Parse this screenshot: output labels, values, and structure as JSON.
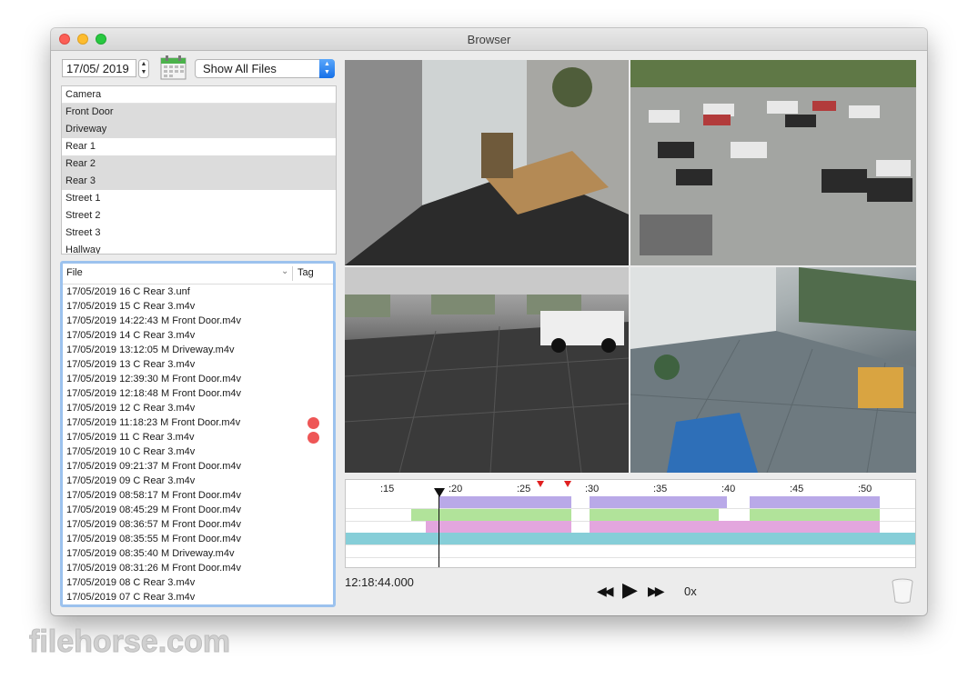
{
  "window": {
    "title": "Browser"
  },
  "toolbar": {
    "date_value": "17/05/ 2019",
    "filter_selected": "Show All Files"
  },
  "cameras": {
    "header": "Camera",
    "items": [
      {
        "label": "Front Door",
        "selected": true
      },
      {
        "label": "Driveway",
        "selected": true
      },
      {
        "label": "Rear 1",
        "selected": false
      },
      {
        "label": "Rear 2",
        "selected": true
      },
      {
        "label": "Rear 3",
        "selected": true
      },
      {
        "label": "Street 1",
        "selected": false
      },
      {
        "label": "Street 2",
        "selected": false
      },
      {
        "label": "Street 3",
        "selected": false
      },
      {
        "label": "Hallway",
        "selected": false
      }
    ]
  },
  "files": {
    "col_file": "File",
    "col_tag": "Tag",
    "rows": [
      {
        "name": "17/05/2019 16 C Rear 3.unf",
        "tag": false
      },
      {
        "name": "17/05/2019 15 C Rear 3.m4v",
        "tag": false
      },
      {
        "name": "17/05/2019 14:22:43 M Front Door.m4v",
        "tag": false
      },
      {
        "name": "17/05/2019 14 C Rear 3.m4v",
        "tag": false
      },
      {
        "name": "17/05/2019 13:12:05 M Driveway.m4v",
        "tag": false
      },
      {
        "name": "17/05/2019 13 C Rear 3.m4v",
        "tag": false
      },
      {
        "name": "17/05/2019 12:39:30 M Front Door.m4v",
        "tag": false
      },
      {
        "name": "17/05/2019 12:18:48 M Front Door.m4v",
        "tag": false
      },
      {
        "name": "17/05/2019 12 C Rear 3.m4v",
        "tag": false
      },
      {
        "name": "17/05/2019 11:18:23 M Front Door.m4v",
        "tag": true
      },
      {
        "name": "17/05/2019 11 C Rear 3.m4v",
        "tag": true
      },
      {
        "name": "17/05/2019 10 C Rear 3.m4v",
        "tag": false
      },
      {
        "name": "17/05/2019 09:21:37 M Front Door.m4v",
        "tag": false
      },
      {
        "name": "17/05/2019 09 C Rear 3.m4v",
        "tag": false
      },
      {
        "name": "17/05/2019 08:58:17 M Front Door.m4v",
        "tag": false
      },
      {
        "name": "17/05/2019 08:45:29 M Front Door.m4v",
        "tag": false
      },
      {
        "name": "17/05/2019 08:36:57 M Front Door.m4v",
        "tag": false
      },
      {
        "name": "17/05/2019 08:35:55 M Front Door.m4v",
        "tag": false
      },
      {
        "name": "17/05/2019 08:35:40 M Driveway.m4v",
        "tag": false
      },
      {
        "name": "17/05/2019 08:31:26 M Front Door.m4v",
        "tag": false
      },
      {
        "name": "17/05/2019 08 C Rear 3.m4v",
        "tag": false
      },
      {
        "name": "17/05/2019 07 C Rear 3.m4v",
        "tag": false
      }
    ]
  },
  "timeline": {
    "ticks": [
      ":15",
      ":20",
      ":25",
      ":30",
      ":35",
      ":40",
      ":45",
      ":50"
    ]
  },
  "playback": {
    "timecode": "12:18:44.000",
    "speed": "0x"
  },
  "watermark": {
    "text": "filehorse.com"
  },
  "colors": {
    "tag": "#ee5656",
    "track_purple": "#b9a9e8",
    "track_green": "#b1e39a",
    "track_pink": "#e3a6de",
    "track_cyan": "#86ced8",
    "selection": "#dcdcdc",
    "focus_ring": "#9cc2ee"
  }
}
